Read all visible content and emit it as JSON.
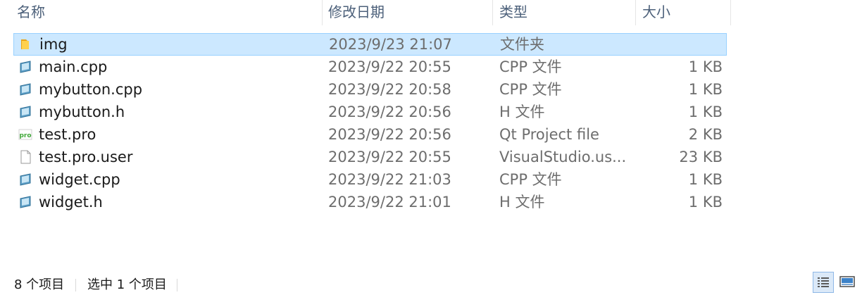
{
  "header": {
    "name": "名称",
    "date": "修改日期",
    "type": "类型",
    "size": "大小"
  },
  "files": [
    {
      "name": "img",
      "date": "2023/9/23 21:07",
      "type": "文件夹",
      "size": "",
      "icon": "folder-icon"
    },
    {
      "name": "main.cpp",
      "date": "2023/9/22 20:55",
      "type": "CPP 文件",
      "size": "1 KB",
      "icon": "cpp-file-icon"
    },
    {
      "name": "mybutton.cpp",
      "date": "2023/9/22 20:58",
      "type": "CPP 文件",
      "size": "1 KB",
      "icon": "cpp-file-icon"
    },
    {
      "name": "mybutton.h",
      "date": "2023/9/22 20:56",
      "type": "H 文件",
      "size": "1 KB",
      "icon": "h-file-icon"
    },
    {
      "name": "test.pro",
      "date": "2023/9/22 20:56",
      "type": "Qt Project file",
      "size": "2 KB",
      "icon": "qt-pro-file-icon"
    },
    {
      "name": "test.pro.user",
      "date": "2023/9/22 20:55",
      "type": "VisualStudio.us...",
      "size": "23 KB",
      "icon": "generic-file-icon"
    },
    {
      "name": "widget.cpp",
      "date": "2023/9/22 21:03",
      "type": "CPP 文件",
      "size": "1 KB",
      "icon": "cpp-file-icon"
    },
    {
      "name": "widget.h",
      "date": "2023/9/22 21:01",
      "type": "H 文件",
      "size": "1 KB",
      "icon": "h-file-icon"
    }
  ],
  "status": {
    "item_count": "8 个项目",
    "selected": "选中 1 个项目"
  },
  "icons": {
    "pro_label": "pro"
  },
  "colors": {
    "selection_bg": "#cce8ff",
    "selection_border": "#99d1ff",
    "header_text": "#4c607a"
  }
}
